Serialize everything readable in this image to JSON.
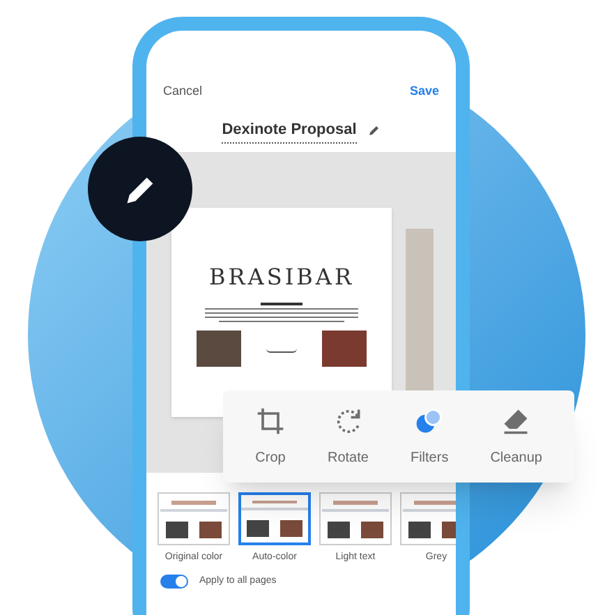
{
  "header": {
    "cancel": "Cancel",
    "save": "Save",
    "title": "Dexinote Proposal"
  },
  "document": {
    "logo": "BRASIBAR"
  },
  "tools": [
    {
      "kind": "crop",
      "label": "Crop",
      "selected": false
    },
    {
      "kind": "rotate",
      "label": "Rotate",
      "selected": false
    },
    {
      "kind": "filters",
      "label": "Filters",
      "selected": true
    },
    {
      "kind": "cleanup",
      "label": "Cleanup",
      "selected": false
    }
  ],
  "filters": [
    {
      "label": "Original color",
      "selected": false
    },
    {
      "label": "Auto-color",
      "selected": true
    },
    {
      "label": "Light text",
      "selected": false
    },
    {
      "label": "Grey",
      "selected": false
    }
  ],
  "apply_all": {
    "label": "Apply to all pages",
    "on": true
  }
}
